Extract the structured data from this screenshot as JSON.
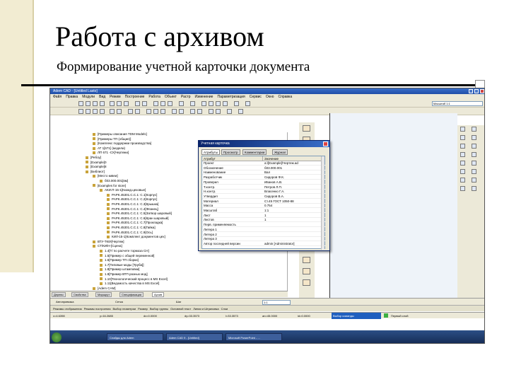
{
  "slide": {
    "title": "Работа с архивом",
    "subtitle": "Формирование учетной карточки документа"
  },
  "app": {
    "window_title": "Adem CAD - [Untitled Lasto]",
    "menu": [
      "Файл",
      "Правка",
      "Модули",
      "Вид",
      "Режим",
      "Построение",
      "Работа",
      "Объект",
      "Растр",
      "Изменение",
      "Параметризация",
      "Сервис",
      "Окно",
      "Справка"
    ],
    "combo_right": "Масштаб 1:1"
  },
  "tree": {
    "rows": [
      {
        "text": "[Примеры описания TDM Models]",
        "indent": 2
      },
      {
        "text": "[Примеры ТП (общие)]",
        "indent": 2
      },
      {
        "text": "[Комплекс поддержки производства]",
        "indent": 2
      },
      {
        "text": "АТ 1[671] (модели)",
        "indent": 2
      },
      {
        "text": "ЛП 671 -СХ[Чертежи]",
        "indent": 2
      },
      {
        "text": "[Ребоу]",
        "indent": 1
      },
      {
        "text": "[Example]0",
        "indent": 1
      },
      {
        "text": "[Example]8",
        "indent": 1
      },
      {
        "text": "[Библиот]",
        "indent": 1
      },
      {
        "text": "[Место кивеи]",
        "indent": 2
      },
      {
        "text": "б03.000.001[вм]",
        "indent": 3
      },
      {
        "text": "[Examples for store]",
        "indent": 2
      },
      {
        "text": "АКИ.П-15-1[Ккомд.цеховые]",
        "indent": 3
      },
      {
        "text": "РАРК.45301.С.С.1: С.1[Корпус]",
        "indent": 4
      },
      {
        "text": "РАРК.45301.С.С.1: С.2[Корпус]",
        "indent": 4
      },
      {
        "text": "РАРК.45301.С.С.1: С.3[Крышка]",
        "indent": 4
      },
      {
        "text": "РАРК.45301.С.С.1: С.4[Фланец]",
        "indent": 4
      },
      {
        "text": "РАРК.45301.С.С.1: С.5[Затвор шаровый]",
        "indent": 4
      },
      {
        "text": "РАРК.45301.С.С.1: С.6[Кран шаровый]",
        "indent": 4
      },
      {
        "text": "РАРК.45301.С.С.1: С.7[Прокладка]",
        "indent": 4
      },
      {
        "text": "РАРК.45301.С.С.1: С.8[Гайка]",
        "indent": 4
      },
      {
        "text": "РАРК.45301.С.С.1: С.9[Ось]",
        "indent": 4
      },
      {
        "text": "КИЛ-15-1[Комплект документов цех]",
        "indent": 4
      },
      {
        "text": "ВТУ-ТК/И[Чертеж]",
        "indent": 2
      },
      {
        "text": "СТ/КИ/Н-[Сцена]",
        "indent": 2
      },
      {
        "text": "1.4[Т/ по расчете тормоза СН]",
        "indent": 3
      },
      {
        "text": "1.5[Пример с общей переменной]",
        "indent": 3
      },
      {
        "text": "1.6[Пример ТП сборки]",
        "indent": 3
      },
      {
        "text": "1.7[Типовые моды [Труба]]",
        "indent": 3
      },
      {
        "text": "1.8[Пример штамповки]",
        "indent": 3
      },
      {
        "text": "1.9[Пример ВТП разных мод]",
        "indent": 3
      },
      {
        "text": "1.10[Технологический процесс в MS Excel]",
        "indent": 3
      },
      {
        "text": "1.11[Ведомость качества в MS Excel]",
        "indent": 3
      },
      {
        "text": "[Adem CAM]",
        "indent": 2
      }
    ]
  },
  "dialog": {
    "title": "Учетная карточка",
    "tabs": [
      "Атрибуты",
      "Просмотр",
      "Комментарии",
      "Журнал"
    ],
    "col_attr": "Атрибут",
    "col_val": "Значение",
    "rows": [
      {
        "a": "Проект",
        "v": "a:\\[Example]\\Чертеж.ad"
      },
      {
        "a": "Обозначение",
        "v": "б03.000.001"
      },
      {
        "a": "Наименование",
        "v": "Вал"
      },
      {
        "a": "Разработчик",
        "v": "Сидоров Ф.К."
      },
      {
        "a": "Проверил",
        "v": "Иванов А.В."
      },
      {
        "a": "Т.контр.",
        "v": "Петров Л.П."
      },
      {
        "a": "Н.контр.",
        "v": "Власенко Г.А."
      },
      {
        "a": "Утвердил",
        "v": "Сидоров В.А."
      },
      {
        "a": "Материал",
        "v": "Ст.45 ГОСТ 1050-88"
      },
      {
        "a": "Масса",
        "v": "0.754"
      },
      {
        "a": "Масштаб",
        "v": "1:1"
      },
      {
        "a": "Лист",
        "v": "1"
      },
      {
        "a": "Листов",
        "v": "1"
      },
      {
        "a": "Перв. применяемость",
        "v": ""
      },
      {
        "a": "Литера 1",
        "v": ""
      },
      {
        "a": "Литера 2",
        "v": ""
      },
      {
        "a": "Литера 3",
        "v": ""
      },
      {
        "a": "Автор последней версии",
        "v": "admin [Administrator]"
      }
    ]
  },
  "tabs_bottom": [
    "Дерево",
    "Свойства",
    "Маршрут",
    "Спецификация",
    "Архив"
  ],
  "props_bar": {
    "label1": "Автопривязка",
    "label2": "Сетка",
    "label3": "Шаг",
    "value_scale": "1:1"
  },
  "tool_strip": [
    "Режимы отображения",
    "Режимы построения",
    "Выбор геометрии",
    "Размер",
    "Выбор группы",
    "Основной текст",
    "Линии и Штриховка",
    "Слои"
  ],
  "status": {
    "x": "х=4.6398",
    "y": "у=16.2685",
    "dx": "dx=0.0000",
    "dy": "dy=33.3573",
    "len": "l=33.3573",
    "ang": "an=45.0000",
    "id": "id=0.0000",
    "prompt": "Выбор команды",
    "layer": "Первый слой"
  },
  "taskbar": {
    "items": [
      "Слайды для Adem",
      "Adem CAD 9 - [Untitled]",
      "Microsoft PowerPoint - ..."
    ]
  },
  "colors": {
    "rail": "#f2ecd2",
    "titlebar": "#1f4ea8",
    "taskbar": "#1b3566",
    "status_prompt": "#1f5fbf",
    "status_layer": "#3cb043"
  }
}
